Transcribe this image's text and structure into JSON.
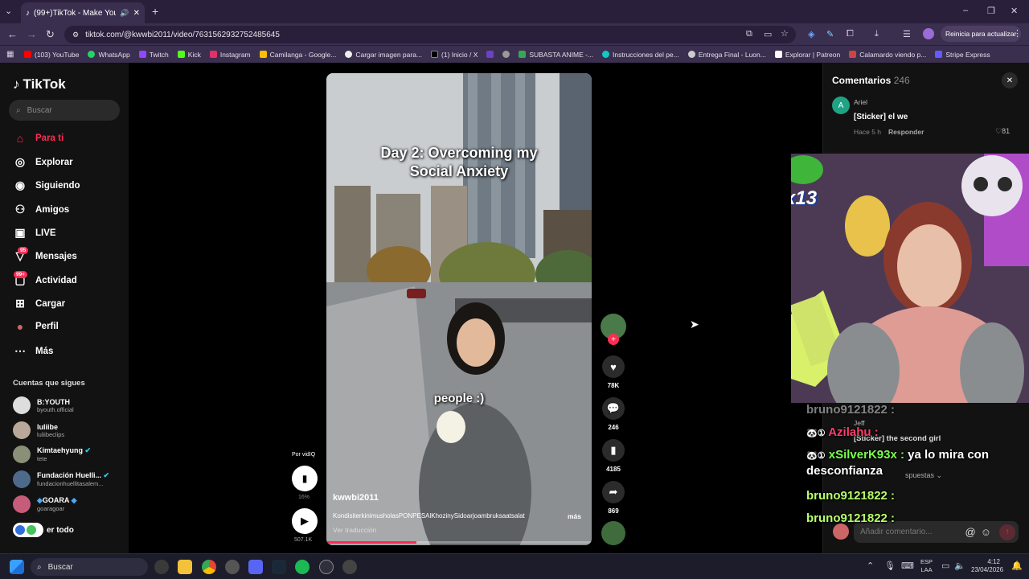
{
  "browser": {
    "tab_title": "(99+)TikTok - Make Your Da",
    "url": "tiktok.com/@kwwbi2011/video/7631562932752485645",
    "update_button": "Reinicia para actualizar",
    "bookmarks": [
      "(103) YouTube",
      "WhatsApp",
      "Twitch",
      "Kick",
      "Instagram",
      "Camilanga - Google...",
      "Cargar imagen para...",
      "(1) Inicio / X",
      "",
      "",
      "SUBASTA ANIME -...",
      "Instrucciones del pe...",
      "Entrega Final - Luon...",
      "Explorar | Patreon",
      "Calamardo viendo p...",
      "Stripe Express"
    ]
  },
  "sidebar": {
    "logo": "TikTok",
    "search_placeholder": "Buscar",
    "nav": [
      "Para ti",
      "Explorar",
      "Siguiendo",
      "Amigos",
      "LIVE",
      "Mensajes",
      "Actividad",
      "Cargar",
      "Perfil",
      "Más"
    ],
    "messages_badge": "95",
    "activity_badge": "99+",
    "following_title": "Cuentas que sigues",
    "accounts": [
      {
        "name": "B:YOUTH",
        "handle": "byouth.official"
      },
      {
        "name": "luliibe",
        "handle": "luliibeclips"
      },
      {
        "name": "Kimtaehyung",
        "handle": "tete"
      },
      {
        "name": "Fundación Huelli...",
        "handle": "fundacionhuellitasalem..."
      },
      {
        "name": "GOARA",
        "handle": "goaragoar"
      }
    ],
    "see_all": "er todo"
  },
  "video": {
    "overlay_title": "Day 2: Overcoming my Social Anxiety",
    "caption_word": "people :)",
    "author": "kwwbi2011",
    "description": "KondisiterkinimusholasPONPESAlKhozinySidoarjoambruksaatsalat",
    "more": "más",
    "translate": "Ver traducción",
    "by_label": "Por vidIQ",
    "percent": "16%",
    "views": "507.1K",
    "progress": 0.34
  },
  "actions": {
    "likes": "78K",
    "comments": "246",
    "saves": "4185",
    "shares": "869"
  },
  "comments": {
    "title": "Comentarios",
    "count": "246",
    "first": {
      "author": "Ariel",
      "text": "[Sticker] el we",
      "time": "Hace 5 h",
      "reply": "Responder",
      "likes": "81"
    },
    "second_author": "Jeff",
    "second_text": "[Sticker] the second girl",
    "replies_label": "spuestas",
    "input_placeholder": "Añadir comentario..."
  },
  "stream_chat": {
    "top_user": "bruno9121822 :",
    "lines": [
      {
        "user": "Azilahu :",
        "text": "",
        "color": "#ff3d6e"
      },
      {
        "user": "xSilverK93x :",
        "text": "ya lo mira con desconfianza",
        "color": "#7cff4d"
      },
      {
        "user": "bruno9121822 :",
        "text": "",
        "color": "#b7ff6a"
      },
      {
        "user": "bruno9121822 :",
        "text": "",
        "color": "#b7ff6a"
      }
    ],
    "sticker_count": "x13"
  },
  "taskbar": {
    "search": "Buscar",
    "lang": "ESP",
    "lang2": "LAA",
    "time": "4:12",
    "date": "23/04/2026"
  }
}
